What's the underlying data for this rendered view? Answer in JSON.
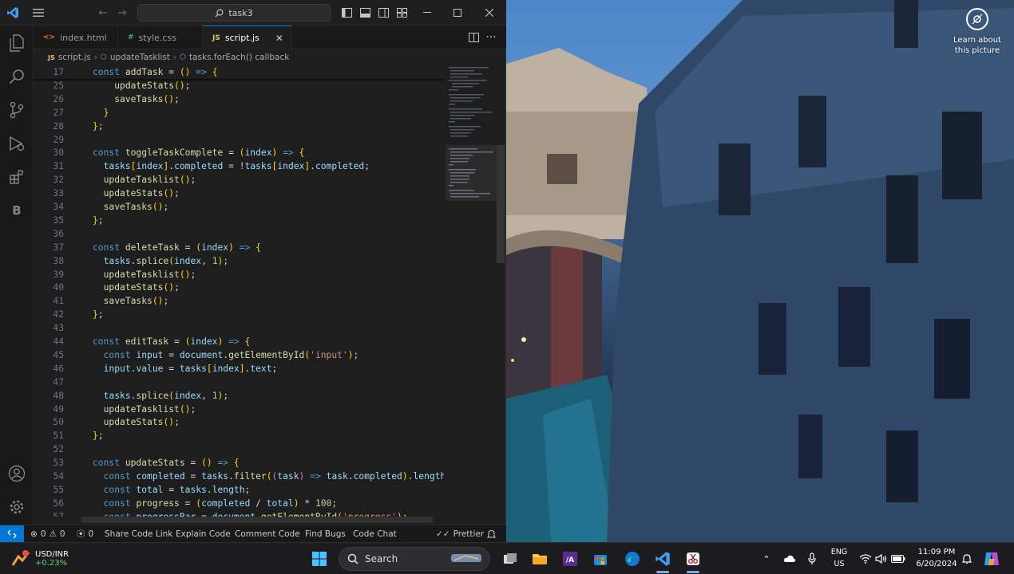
{
  "titlebar": {
    "search_text": "task3"
  },
  "tabs": [
    {
      "label": "index.html",
      "icon": "html-file-icon",
      "active": false
    },
    {
      "label": "style.css",
      "icon": "css-file-icon",
      "active": false
    },
    {
      "label": "script.js",
      "icon": "js-file-icon",
      "active": true
    }
  ],
  "breadcrumb": {
    "file": "script.js",
    "symbol1": "updateTasklist",
    "symbol2": "tasks.forEach() callback"
  },
  "editor": {
    "lines": [
      {
        "n": "17",
        "text": "const addTask = () => {"
      },
      {
        "n": "25",
        "text": "    updateStats();"
      },
      {
        "n": "26",
        "text": "    saveTasks();"
      },
      {
        "n": "27",
        "text": "  }"
      },
      {
        "n": "28",
        "text": "};"
      },
      {
        "n": "29",
        "text": ""
      },
      {
        "n": "30",
        "text": "const toggleTaskComplete = (index) => {"
      },
      {
        "n": "31",
        "text": "  tasks[index].completed = !tasks[index].completed;"
      },
      {
        "n": "32",
        "text": "  updateTasklist();"
      },
      {
        "n": "33",
        "text": "  updateStats();"
      },
      {
        "n": "34",
        "text": "  saveTasks();"
      },
      {
        "n": "35",
        "text": "};"
      },
      {
        "n": "36",
        "text": ""
      },
      {
        "n": "37",
        "text": "const deleteTask = (index) => {"
      },
      {
        "n": "38",
        "text": "  tasks.splice(index, 1);"
      },
      {
        "n": "39",
        "text": "  updateTasklist();"
      },
      {
        "n": "40",
        "text": "  updateStats();"
      },
      {
        "n": "41",
        "text": "  saveTasks();"
      },
      {
        "n": "42",
        "text": "};"
      },
      {
        "n": "43",
        "text": ""
      },
      {
        "n": "44",
        "text": "const editTask = (index) => {"
      },
      {
        "n": "45",
        "text": "  const input = document.getElementById('input');"
      },
      {
        "n": "46",
        "text": "  input.value = tasks[index].text;"
      },
      {
        "n": "47",
        "text": ""
      },
      {
        "n": "48",
        "text": "  tasks.splice(index, 1);"
      },
      {
        "n": "49",
        "text": "  updateTasklist();"
      },
      {
        "n": "50",
        "text": "  updateStats();"
      },
      {
        "n": "51",
        "text": "};"
      },
      {
        "n": "52",
        "text": ""
      },
      {
        "n": "53",
        "text": "const updateStats = () => {"
      },
      {
        "n": "54",
        "text": "  const completed = tasks.filter((task) => task.completed).length"
      },
      {
        "n": "55",
        "text": "  const total = tasks.length;"
      },
      {
        "n": "56",
        "text": "  const progress = (completed / total) * 100;"
      },
      {
        "n": "57",
        "text": "  const progressBar = document.getElementById('progress');"
      }
    ]
  },
  "statusbar": {
    "errors": "0",
    "warnings": "0",
    "ports": "0",
    "items": [
      "Share Code Link",
      "Explain Code",
      "Comment Code",
      "Find Bugs",
      "Code Chat"
    ],
    "prettier": "Prettier"
  },
  "desktop": {
    "learn_about_line1": "Learn about",
    "learn_about_line2": "this picture"
  },
  "taskbar": {
    "weather_title": "USD/INR",
    "weather_value": "+0.23%",
    "search_label": "Search",
    "lang_line1": "ENG",
    "lang_line2": "US",
    "time": "11:09 PM",
    "date": "6/20/2024"
  },
  "colors": {
    "accent": "#0078d4",
    "editor_bg": "#1e1e1e",
    "keyword": "#569cd6",
    "function": "#dcdcaa",
    "variable": "#9cdcfe",
    "string": "#ce9178",
    "number": "#b5cea8"
  }
}
